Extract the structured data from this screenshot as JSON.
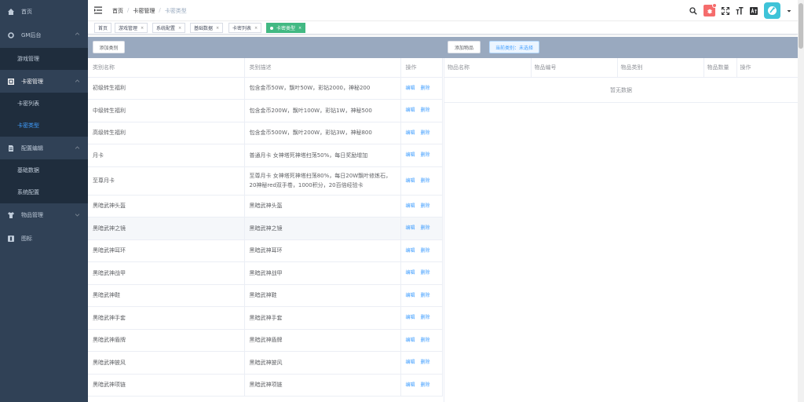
{
  "sidebar": {
    "home": "首页",
    "gm": "GM后台",
    "gm_items": [
      "游戏管理"
    ],
    "card": "卡密管理",
    "card_items": [
      "卡密列表",
      "卡密类型"
    ],
    "config": "配置编辑",
    "config_items": [
      "基础数据",
      "系统配置"
    ],
    "goods": "物品管理",
    "icons": "图标"
  },
  "navbar": {
    "breadcrumb": [
      "首页",
      "卡密管理",
      "卡密类型"
    ]
  },
  "tags": [
    "首页",
    "游戏管理",
    "系统配置",
    "基础数据",
    "卡密列表",
    "卡密类型"
  ],
  "toolbar": {
    "add_category": "添加类别",
    "add_item": "添加物品",
    "current_category": "当前类别：未选择"
  },
  "left_table": {
    "headers": [
      "类别名称",
      "类别描述",
      "操作"
    ],
    "action_edit": "编辑",
    "action_delete": "删除",
    "rows": [
      {
        "name": "初级转生福利",
        "desc": "包含金币50W，飘叶50W，彩钻2000，神秘200"
      },
      {
        "name": "中级转生福利",
        "desc": "包含金币200W，飘叶100W，彩钻1W，神秘500"
      },
      {
        "name": "高级转生福利",
        "desc": "包含金币500W，飘叶200W，彩钻3W，神秘800"
      },
      {
        "name": "月卡",
        "desc": "普通月卡 女神塔死神塔扫荡50%，每日奖励增加"
      },
      {
        "name": "至尊月卡",
        "desc": "至尊月卡 女神塔死神塔扫荡80%，每日20W飘叶修炼石，20神秘red双手卷，1000积分，20百倍经验卡"
      },
      {
        "name": "黑暗武神头盔",
        "desc": "黑暗武神头盔"
      },
      {
        "name": "黑暗武神之镜",
        "desc": "黑暗武神之镜"
      },
      {
        "name": "黑暗武神耳环",
        "desc": "黑暗武神耳环"
      },
      {
        "name": "黑暗武神战甲",
        "desc": "黑暗武神战甲"
      },
      {
        "name": "黑暗武神鞋",
        "desc": "黑暗武神鞋"
      },
      {
        "name": "黑暗武神手套",
        "desc": "黑暗武神手套"
      },
      {
        "name": "黑暗武神盾牌",
        "desc": "黑暗武神盾牌"
      },
      {
        "name": "黑暗武神披风",
        "desc": "黑暗武神披风"
      },
      {
        "name": "黑暗武神项链",
        "desc": "黑暗武神项链"
      }
    ]
  },
  "right_table": {
    "headers": [
      "物品名称",
      "物品编号",
      "物品类别",
      "物品数量",
      "操作"
    ],
    "empty": "暂无数据"
  }
}
